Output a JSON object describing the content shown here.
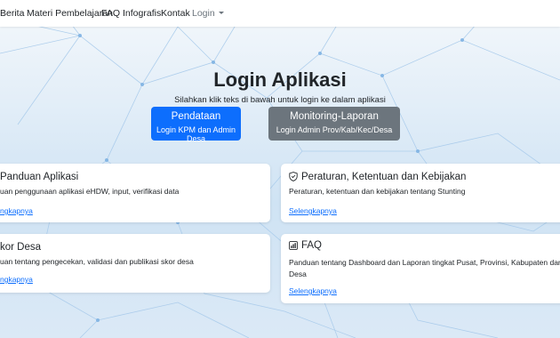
{
  "nav": {
    "items": [
      "Berita",
      "Materi Pembelajaran",
      "FAQ",
      "Infografis",
      "Kontak"
    ],
    "login_label": "Login"
  },
  "hero": {
    "title": "Login Aplikasi",
    "subtitle": "Silahkan klik teks di bawah untuk login ke dalam aplikasi",
    "primary_button": {
      "label": "Pendataan",
      "sublabel": "Login KPM dan Admin Desa"
    },
    "secondary_button": {
      "label": "Monitoring-Laporan",
      "sublabel": "Login Admin Prov/Kab/Kec/Desa"
    }
  },
  "cards": {
    "panduan": {
      "title": "Panduan Aplikasi",
      "text": "uan penggunaan aplikasi eHDW, input, verifikasi data",
      "link": "ngkapnya"
    },
    "skor": {
      "title": "kor Desa",
      "text": "uan tentang pengecekan, validasi dan publikasi skor desa",
      "link": "ngkapnya"
    },
    "peraturan": {
      "title": "Peraturan, Ketentuan dan Kebijakan",
      "text": "Peraturan, ketentuan dan kebijakan tentang Stunting",
      "link": "Selengkapnya",
      "icon": "shield-icon"
    },
    "faq": {
      "title": "FAQ",
      "text": "Panduan tentang Dashboard dan Laporan tingkat Pusat, Provinsi, Kabupaten dan Desa",
      "link": "Selengkapnya",
      "icon": "chart-icon"
    }
  },
  "colors": {
    "primary": "#0d6efd",
    "secondary": "#6c757d",
    "link": "#0d6efd"
  }
}
